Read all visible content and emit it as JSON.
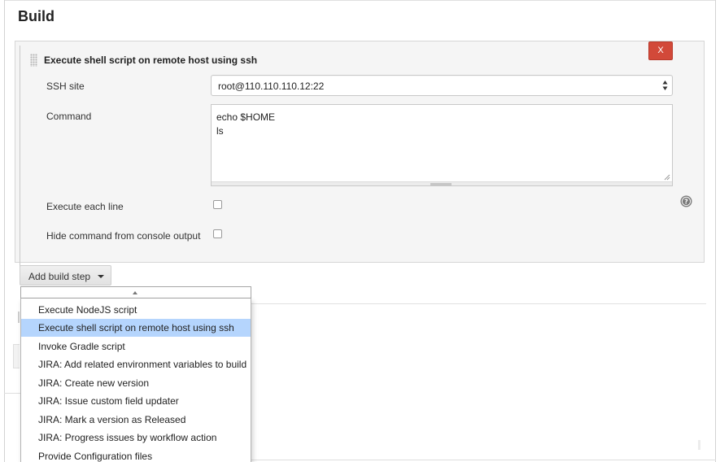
{
  "section": {
    "title": "Build"
  },
  "build_step": {
    "title": "Execute shell script on remote host using ssh",
    "delete_label": "X",
    "ssh_site_label": "SSH site",
    "ssh_site_value": "root@110.110.110.12:22",
    "command_label": "Command",
    "command_lines": [
      "echo $HOME",
      "ls"
    ],
    "execute_each_line_label": "Execute each line",
    "execute_each_line_checked": false,
    "hide_command_label": "Hide command from console output",
    "hide_command_checked": false
  },
  "add_build_step": {
    "label": "Add build step"
  },
  "dropdown": {
    "items": [
      {
        "label": "Execute NodeJS script",
        "highlighted": false
      },
      {
        "label": "Execute shell script on remote host using ssh",
        "highlighted": true
      },
      {
        "label": "Invoke Gradle script",
        "highlighted": false
      },
      {
        "label": "JIRA: Add related environment variables to build",
        "highlighted": false
      },
      {
        "label": "JIRA: Create new version",
        "highlighted": false
      },
      {
        "label": "JIRA: Issue custom field updater",
        "highlighted": false
      },
      {
        "label": "JIRA: Mark a version as Released",
        "highlighted": false
      },
      {
        "label": "JIRA: Progress issues by workflow action",
        "highlighted": false
      },
      {
        "label": "Provide Configuration files",
        "highlighted": false
      }
    ]
  },
  "colors": {
    "delete_button": "#d24939",
    "highlight": "#b5d5fd",
    "panel_background": "#f5f5f5"
  },
  "icons": {
    "help": "help-icon",
    "select_arrows": "up-down-arrows-icon",
    "drag_handle": "drag-handle-icon",
    "caret": "caret-down-icon"
  }
}
